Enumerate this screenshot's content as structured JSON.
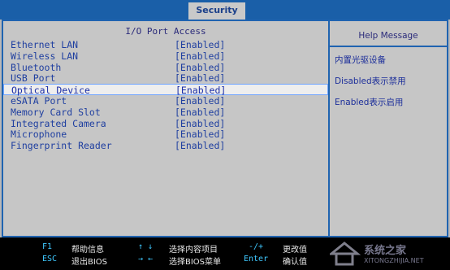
{
  "header": {
    "active_tab": "Security"
  },
  "section": {
    "title": "I/O Port Access"
  },
  "rows": [
    {
      "label": "Ethernet LAN",
      "value": "[Enabled]"
    },
    {
      "label": "Wireless LAN",
      "value": "[Enabled]"
    },
    {
      "label": "Bluetooth",
      "value": "[Enabled]"
    },
    {
      "label": "USB Port",
      "value": "[Enabled]"
    },
    {
      "label": "Optical Device",
      "value": "[Enabled]",
      "selected": true
    },
    {
      "label": "eSATA Port",
      "value": "[Enabled]"
    },
    {
      "label": "Memory Card Slot",
      "value": "[Enabled]"
    },
    {
      "label": "Integrated Camera",
      "value": "[Enabled]"
    },
    {
      "label": "Microphone",
      "value": "[Enabled]"
    },
    {
      "label": "Fingerprint Reader",
      "value": "[Enabled]"
    }
  ],
  "help": {
    "title": "Help Message",
    "lines": [
      "内置光驱设备",
      "Disabled表示禁用",
      "Enabled表示启用"
    ]
  },
  "footer": {
    "items": [
      {
        "key": "F1",
        "desc": "帮助信息"
      },
      {
        "key": "ESC",
        "desc": "退出BIOS"
      },
      {
        "key": "↑ ↓",
        "desc": "选择内容项目"
      },
      {
        "key": "→ ←",
        "desc": "选择BIOS菜单"
      },
      {
        "key": "-/+",
        "desc": "更改值"
      },
      {
        "key": "Enter",
        "desc": "确认值"
      }
    ]
  },
  "watermark": {
    "text": "系统之家",
    "url": "XITONGZHIJIA.NET"
  }
}
